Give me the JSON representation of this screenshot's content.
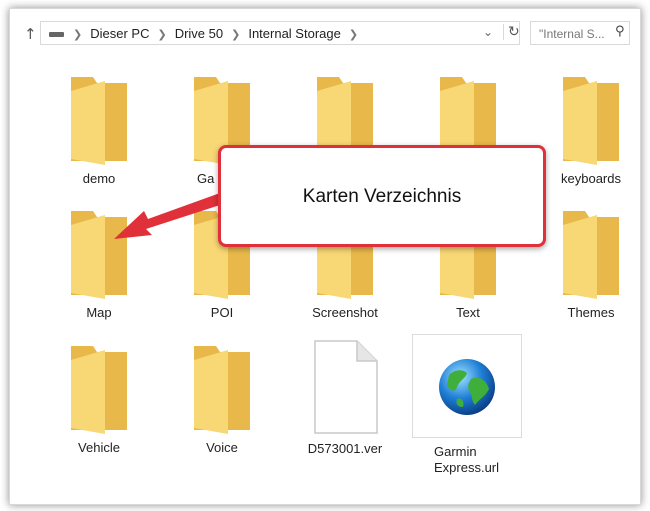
{
  "address": {
    "crumbs": [
      "Dieser PC",
      "Drive 50",
      "Internal Storage"
    ],
    "search_placeholder": "\"Internal S..."
  },
  "items": [
    {
      "label": "demo",
      "type": "folder"
    },
    {
      "label": "Ga",
      "type": "folder"
    },
    {
      "label": "",
      "type": "folder"
    },
    {
      "label": "",
      "type": "folder"
    },
    {
      "label": "keyboards",
      "type": "folder"
    },
    {
      "label": "Map",
      "type": "folder"
    },
    {
      "label": "POI",
      "type": "folder"
    },
    {
      "label": "Screenshot",
      "type": "folder"
    },
    {
      "label": "Text",
      "type": "folder"
    },
    {
      "label": "Themes",
      "type": "folder"
    },
    {
      "label": "Vehicle",
      "type": "folder"
    },
    {
      "label": "Voice",
      "type": "folder"
    },
    {
      "label": "D573001.ver",
      "type": "file"
    },
    {
      "label": "Garmin Express.url",
      "type": "url"
    }
  ],
  "callout": {
    "text": "Karten Verzeichnis",
    "border_color": "#e0303a"
  },
  "colors": {
    "folder_front": "#f8d775",
    "folder_back": "#e8b84a"
  }
}
